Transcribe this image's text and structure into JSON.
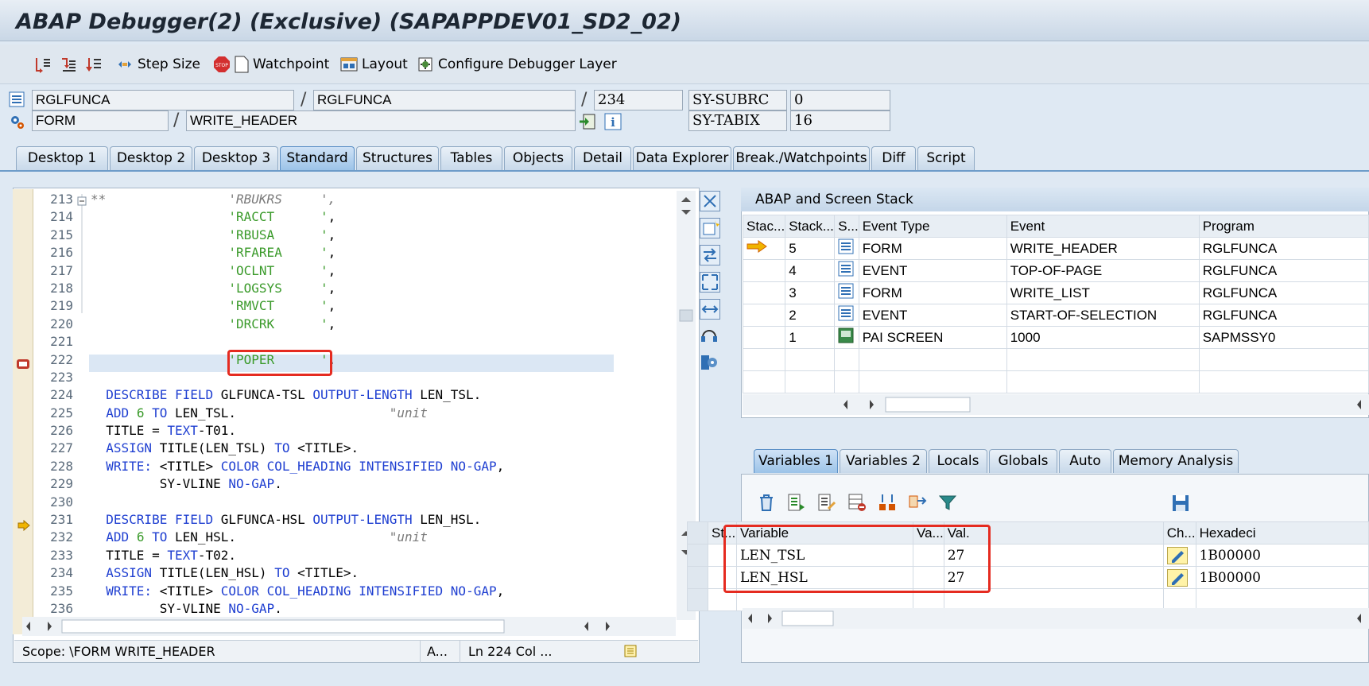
{
  "window": {
    "title": "ABAP Debugger(2)  (Exclusive) (SAPAPPDEV01_SD2_02)"
  },
  "toolbar": {
    "step_size": "Step Size",
    "watchpoint": "Watchpoint",
    "layout": "Layout",
    "configure": "Configure Debugger Layer"
  },
  "header": {
    "program_main": "RGLFUNCA",
    "program_include": "RGLFUNCA",
    "line": "234",
    "event_type": "FORM",
    "event_name": "WRITE_HEADER",
    "sy_subrc_label": "SY-SUBRC",
    "sy_subrc_value": "0",
    "sy_tabix_label": "SY-TABIX",
    "sy_tabix_value": "16"
  },
  "tabs": [
    "Desktop 1",
    "Desktop 2",
    "Desktop 3",
    "Standard",
    "Structures",
    "Tables",
    "Objects",
    "Detail",
    "Data Explorer",
    "Break./Watchpoints",
    "Diff",
    "Script"
  ],
  "code": {
    "line_numbers": [
      "213",
      "214",
      "215",
      "216",
      "217",
      "218",
      "219",
      "220",
      "221",
      "222",
      "223",
      "224",
      "225",
      "226",
      "227",
      "228",
      "229",
      "230",
      "231",
      "232",
      "233",
      "234",
      "235",
      "236"
    ],
    "lines": [
      {
        "t": "**                'RBUKRS     ',"
      },
      {
        "t": "                  'RACCT      ',"
      },
      {
        "t": "                  'RBUSA      ',"
      },
      {
        "t": "                  'RFAREA     ',"
      },
      {
        "t": "                  'OCLNT      ',"
      },
      {
        "t": "                  'LOGSYS     ',"
      },
      {
        "t": "                  'RMVCT      ',"
      },
      {
        "t": "                  'DRCRK      ',"
      },
      {
        "t": ""
      },
      {
        "t": "                  'POPER      '."
      },
      {
        "t": ""
      },
      {
        "t": "  DESCRIBE FIELD GLFUNCA-TSL OUTPUT-LENGTH LEN_TSL."
      },
      {
        "t": "  ADD 6 TO LEN_TSL.                    \"unit"
      },
      {
        "t": "  TITLE = TEXT-T01."
      },
      {
        "t": "  ASSIGN TITLE(LEN_TSL) TO <TITLE>."
      },
      {
        "t": "  WRITE: <TITLE> COLOR COL_HEADING INTENSIFIED NO-GAP,"
      },
      {
        "t": "         SY-VLINE NO-GAP."
      },
      {
        "t": ""
      },
      {
        "t": "  DESCRIBE FIELD GLFUNCA-HSL OUTPUT-LENGTH LEN_HSL."
      },
      {
        "t": "  ADD 6 TO LEN_HSL.                    \"unit"
      },
      {
        "t": "  TITLE = TEXT-T02."
      },
      {
        "t": "  ASSIGN TITLE(LEN_HSL) TO <TITLE>."
      },
      {
        "t": "  WRITE: <TITLE> COLOR COL_HEADING INTENSIFIED NO-GAP,"
      },
      {
        "t": "         SY-VLINE NO-GAP."
      }
    ]
  },
  "status": {
    "scope": "Scope: \\FORM WRITE_HEADER",
    "mode": "A...",
    "position": "Ln 224 Col ..."
  },
  "stack": {
    "title": "ABAP and Screen Stack",
    "columns": [
      "Stac...",
      "Stack...",
      "S...",
      "Event Type",
      "Event",
      "Program"
    ],
    "rows": [
      {
        "level": "5",
        "type": "FORM",
        "event": "WRITE_HEADER",
        "program": "RGLFUNCA",
        "current": true
      },
      {
        "level": "4",
        "type": "EVENT",
        "event": "TOP-OF-PAGE",
        "program": "RGLFUNCA"
      },
      {
        "level": "3",
        "type": "FORM",
        "event": "WRITE_LIST",
        "program": "RGLFUNCA"
      },
      {
        "level": "2",
        "type": "EVENT",
        "event": "START-OF-SELECTION",
        "program": "RGLFUNCA"
      },
      {
        "level": "1",
        "type": "PAI SCREEN",
        "event": "1000",
        "program": "SAPMSSY0"
      }
    ]
  },
  "var_tabs": [
    "Variables 1",
    "Variables 2",
    "Locals",
    "Globals",
    "Auto",
    "Memory Analysis"
  ],
  "variables": {
    "columns": [
      "St...",
      "Variable",
      "Va...",
      "Val.",
      "Ch...",
      "Hexadeci"
    ],
    "rows": [
      {
        "name": "LEN_TSL",
        "value": "27",
        "hex": "1B00000"
      },
      {
        "name": "LEN_HSL",
        "value": "27",
        "hex": "1B00000"
      }
    ]
  },
  "colors": {
    "highlight": "#e52b20",
    "keyword": "#1f3fd1",
    "string": "#3a9a2a"
  }
}
